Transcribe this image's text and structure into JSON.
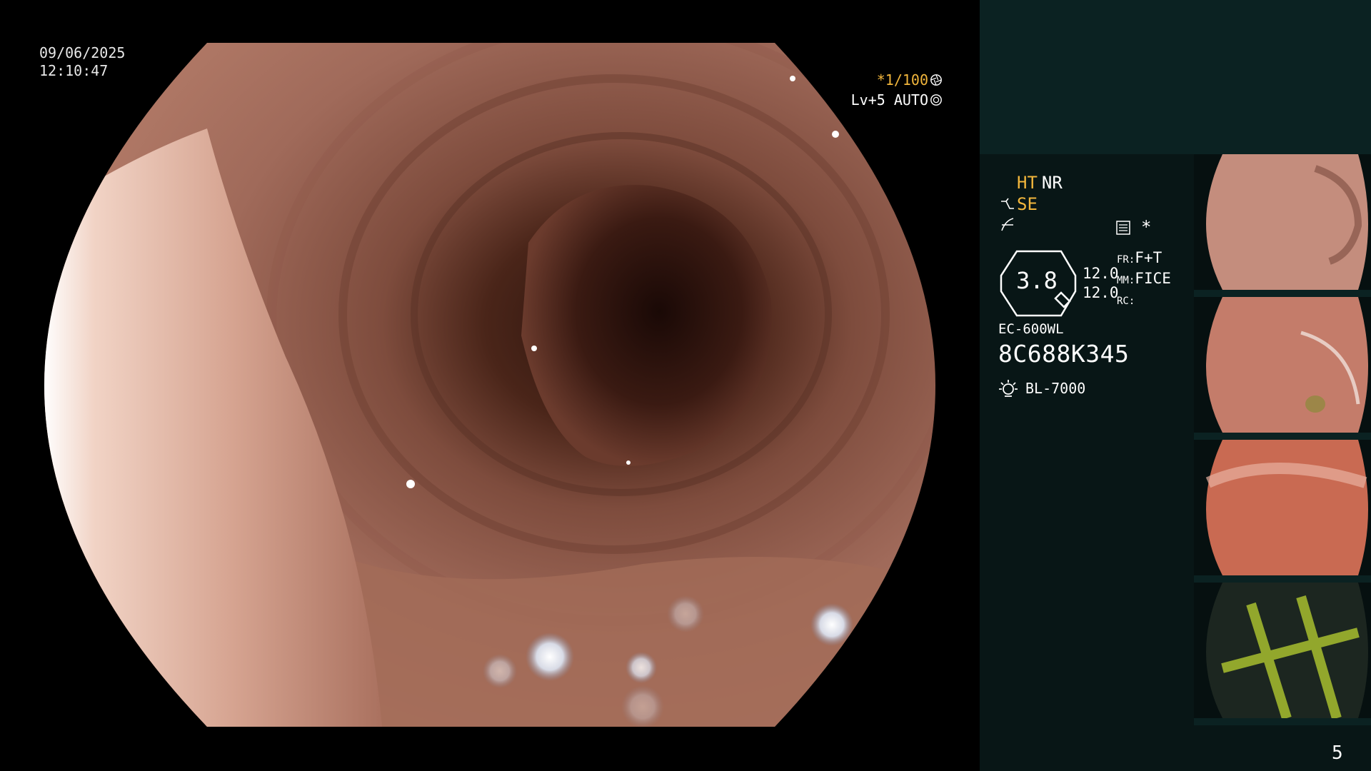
{
  "overlay": {
    "date": "09/06/2025",
    "time": "12:10:47",
    "shutter": "*1/100",
    "level": "Lv+5 AUTO"
  },
  "info": {
    "ht": "HT",
    "nr": "NR",
    "se": "SE",
    "octagon_value": "3.8",
    "level_a": "12.0",
    "level_b": "12.0",
    "modes": [
      {
        "key": "FR:",
        "value": "F+T"
      },
      {
        "key": "MM:",
        "value": "FICE"
      },
      {
        "key": "RC:",
        "value": ""
      }
    ],
    "star": "*",
    "scope_model": "EC-600WL",
    "serial": "8C688K345",
    "light_source": "BL-7000"
  },
  "page_number": "5",
  "thumbnails": [
    {
      "id": "thumb-1",
      "scene": "mucosa-pale-fold",
      "colors": [
        "#c98e7e",
        "#8a5a4c"
      ]
    },
    {
      "id": "thumb-2",
      "scene": "mucosa-fold-reflection",
      "colors": [
        "#c77f6e",
        "#7d4a3c"
      ]
    },
    {
      "id": "thumb-3",
      "scene": "mucosa-red-close",
      "colors": [
        "#d0705a",
        "#7e3b2d"
      ]
    },
    {
      "id": "thumb-4",
      "scene": "striped-fabric",
      "colors": [
        "#1f2a22",
        "#9fb62e"
      ]
    }
  ]
}
